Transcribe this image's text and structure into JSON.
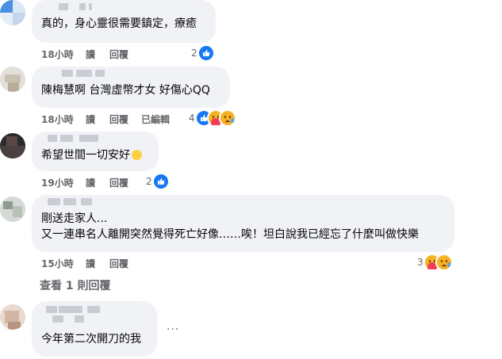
{
  "comments": [
    {
      "text": "真的，身心靈很需要鎮定，療癒",
      "time": "18小時",
      "reply_action": "讀",
      "reply_label": "回覆",
      "edited": "",
      "reaction_count": "2",
      "reactions": [
        "like-icon"
      ]
    },
    {
      "text": "陳梅慧啊 台灣虛幣才女 好傷心QQ",
      "time": "18小時",
      "reply_action": "讀",
      "reply_label": "回覆",
      "edited": "已編輯",
      "reaction_count": "4",
      "reactions": [
        "like-icon",
        "care-icon",
        "sad-icon"
      ]
    },
    {
      "text": "希望世間一切安好",
      "inline_emoji": "smile-emoji",
      "time": "19小時",
      "reply_action": "讀",
      "reply_label": "回覆",
      "edited": "",
      "reaction_count": "2",
      "reactions": [
        "like-icon"
      ]
    },
    {
      "text_line1": "剛送走家人...",
      "text_line2": "又一連串名人離開突然覺得死亡好像……唉！坦白說我已經忘了什麼叫做快樂",
      "time": "15小時",
      "reply_action": "讀",
      "reply_label": "回覆",
      "edited": "",
      "reaction_count": "3",
      "reactions": [
        "care-icon",
        "sad-icon"
      ]
    },
    {
      "text": "今年第二次開刀的我",
      "more": "..."
    }
  ],
  "view_replies": "查看 1 則回覆",
  "colors": {
    "bubble": "#f0f2f5",
    "meta": "#65676b",
    "like_blue": "#1877f2"
  }
}
